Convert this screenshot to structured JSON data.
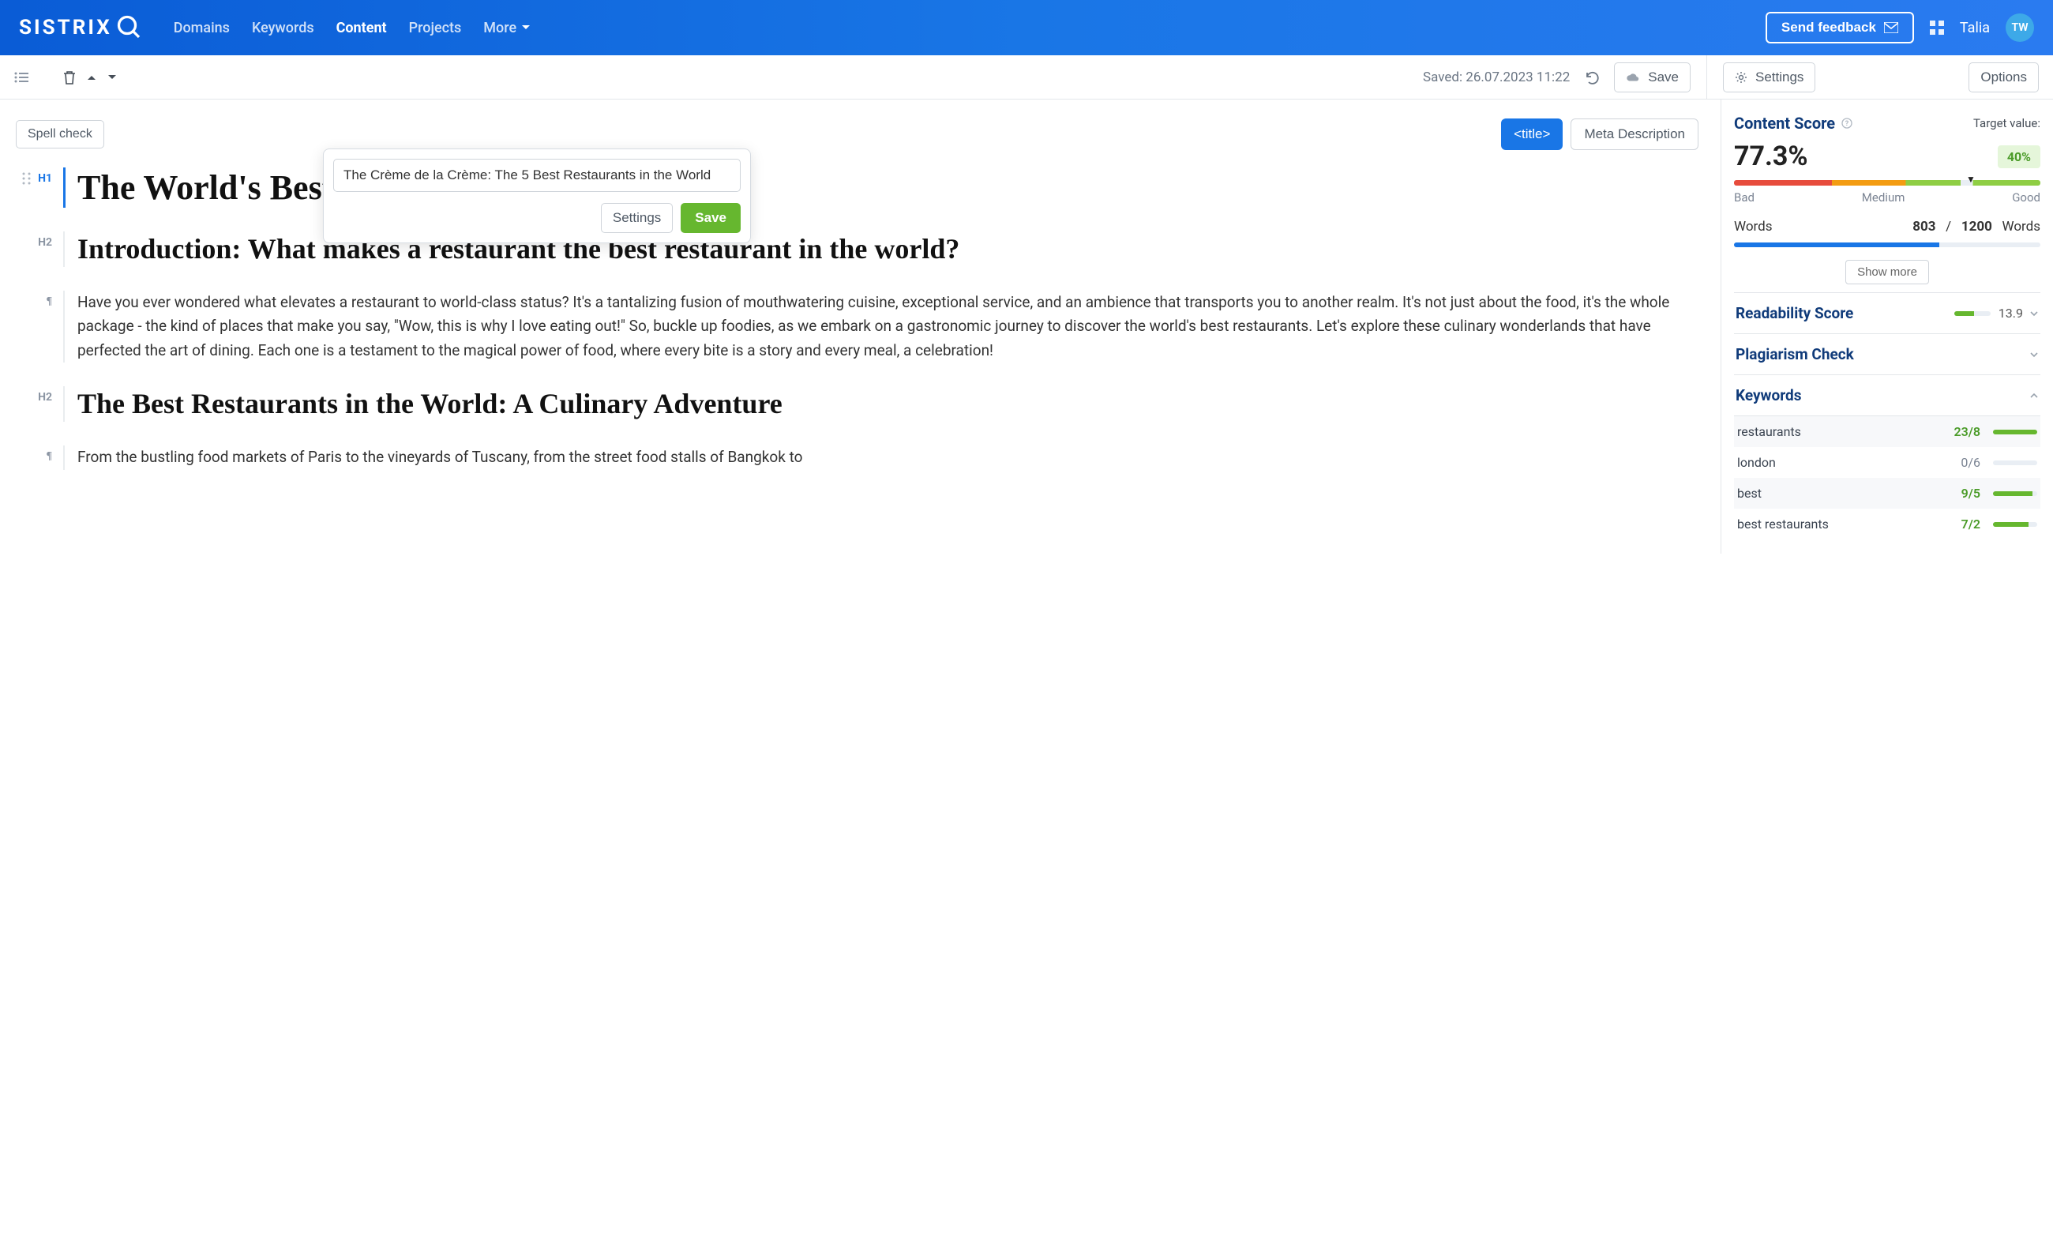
{
  "topnav": {
    "brand": "SISTRIX",
    "items": [
      "Domains",
      "Keywords",
      "Content",
      "Projects",
      "More"
    ],
    "active_index": 2,
    "feedback": "Send feedback",
    "user_name": "Talia",
    "user_initials": "TW"
  },
  "subbar": {
    "saved_text": "Saved: 26.07.2023 11:22",
    "save_btn": "Save",
    "settings_btn": "Settings",
    "options_btn": "Options"
  },
  "editor": {
    "spell_check": "Spell check",
    "title_btn": "<title>",
    "meta_btn": "Meta Description",
    "blocks": {
      "h1": "The World's Best",
      "h2a": "Introduction: What makes a restaurant the best restaurant in the world?",
      "p1": "Have you ever wondered what elevates a restaurant to world-class status? It's a tantalizing fusion of mouthwatering cuisine, exceptional service, and an ambience that transports you to another realm. It's not just about the food, it's the whole package - the kind of places that make you say, \"Wow, this is why I love eating out!\" So, buckle up foodies, as we embark on a gastronomic journey to discover the world's best restaurants. Let's explore these culinary wonderlands that have perfected the art of dining. Each one is a testament to the magical power of food, where every bite is a story and every meal, a celebration!",
      "h2b": "The Best Restaurants in the World: A Culinary Adventure",
      "p2": "From the bustling food markets of Paris to the vineyards of Tuscany, from the street food stalls of Bangkok to"
    },
    "gutters": {
      "h1": "H1",
      "h2": "H2"
    }
  },
  "popover": {
    "value": "The Crème de la Crème: The 5 Best Restaurants in the World",
    "settings": "Settings",
    "save": "Save"
  },
  "sidebar": {
    "content_score": {
      "label": "Content Score",
      "target_label": "Target value:",
      "value": "77.3%",
      "badge": "40%",
      "legend": {
        "bad": "Bad",
        "medium": "Medium",
        "good": "Good"
      }
    },
    "words": {
      "label": "Words",
      "current": "803",
      "sep": "/",
      "target": "1200",
      "unit": "Words"
    },
    "show_more": "Show more",
    "readability": {
      "label": "Readability Score",
      "value": "13.9"
    },
    "plagiarism": {
      "label": "Plagiarism Check"
    },
    "keywords": {
      "label": "Keywords",
      "rows": [
        {
          "name": "restaurants",
          "val": "23/8",
          "pct": 100,
          "good": true
        },
        {
          "name": "london",
          "val": "0/6",
          "pct": 0,
          "good": false
        },
        {
          "name": "best",
          "val": "9/5",
          "pct": 90,
          "good": true
        },
        {
          "name": "best restaurants",
          "val": "7/2",
          "pct": 80,
          "good": true
        }
      ]
    }
  }
}
